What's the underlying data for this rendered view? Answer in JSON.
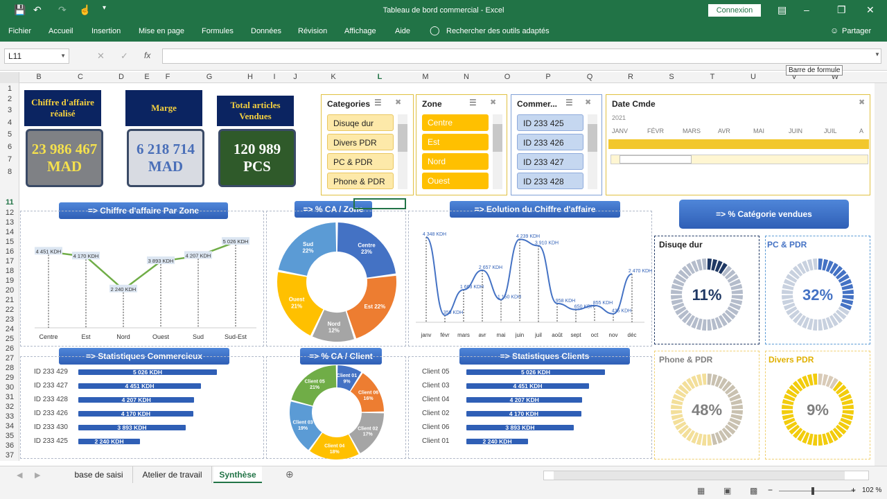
{
  "titlebar": {
    "title": "Tableau de bord commercial  -  Excel",
    "login": "Connexion"
  },
  "ribbon": {
    "tabs": [
      "Fichier",
      "Accueil",
      "Insertion",
      "Mise en page",
      "Formules",
      "Données",
      "Révision",
      "Affichage",
      "Aide"
    ],
    "search": "Rechercher des outils adaptés",
    "share": "Partager"
  },
  "formula": {
    "namebox": "L11",
    "fx": "fx",
    "tooltip": "Barre de formule"
  },
  "columns": [
    "B",
    "C",
    "D",
    "E",
    "F",
    "G",
    "H",
    "I",
    "J",
    "K",
    "L",
    "M",
    "N",
    "O",
    "P",
    "Q",
    "R",
    "S",
    "T",
    "U",
    "V",
    "W"
  ],
  "rows": [
    "1",
    "2",
    "3",
    "4",
    "5",
    "6",
    "7",
    "8",
    "11",
    "12",
    "13",
    "14",
    "15",
    "16",
    "17",
    "18",
    "19",
    "20",
    "21",
    "22",
    "23",
    "24",
    "25",
    "26",
    "27",
    "28",
    "29",
    "30",
    "31",
    "32",
    "33",
    "34",
    "35",
    "36",
    "37"
  ],
  "kpis": [
    {
      "title": "Chiffre d'affaire réalisé",
      "value1": "23 986 467",
      "value2": "MAD",
      "color": "#7f8185",
      "textcolor": "#f4e04d"
    },
    {
      "title": "Marge",
      "value1": "6 218 714",
      "value2": "MAD",
      "color": "#d8dbe2",
      "textcolor": "#4a6fb8"
    },
    {
      "title": "Total articles Vendues",
      "value1": "120 989",
      "value2": "PCS",
      "color": "#2f5a2a",
      "textcolor": "#ffffff"
    }
  ],
  "slicers": {
    "categories": {
      "title": "Categories",
      "items": [
        "Disuqe dur",
        "Divers PDR",
        "PC & PDR",
        "Phone &  PDR"
      ]
    },
    "zone": {
      "title": "Zone",
      "items": [
        "Centre",
        "Est",
        "Nord",
        "Ouest"
      ]
    },
    "commercial": {
      "title": "Commer...",
      "items": [
        "ID 233 425",
        "ID 233 426",
        "ID 233 427",
        "ID 233 428"
      ]
    },
    "date": {
      "title": "Date Cmde",
      "year": "2021",
      "months": [
        "JANV",
        "FÉVR",
        "MARS",
        "AVR",
        "MAI",
        "JUIN",
        "JUIL",
        "A"
      ]
    }
  },
  "banners": {
    "zone_ca": "=> Chiffre  d'affaire Par Zone",
    "pct_zone": "=> % CA / Zone",
    "evolution": "=> Eolution du Chiffre d'affaire",
    "pct_cat": "=> % Catégorie vendues",
    "stat_com": "=> Statistiques Commercieux",
    "pct_client": "=> % CA / Client",
    "stat_cli": "=> Statistiques Clients"
  },
  "chart_data": [
    {
      "type": "line",
      "title": "",
      "categories": [
        "Centre",
        "Est",
        "Nord",
        "Ouest",
        "Sud",
        "Sud-Est"
      ],
      "values": [
        4451,
        4170,
        2240,
        3893,
        4207,
        5026
      ],
      "labels": [
        "4 451 KDH",
        "4 170 KDH",
        "2 240 KDH",
        "3 893 KDH",
        "4 207 KDH",
        "5 026 KDH"
      ]
    },
    {
      "type": "pie",
      "title": "",
      "categories": [
        "Centre",
        "Est",
        "Nord",
        "Ouest",
        "Sud"
      ],
      "values": [
        23,
        22,
        12,
        21,
        22
      ],
      "labels": [
        "Centre\n23%",
        "Est 22%",
        "Nord\n12%",
        "Ouest\n21%",
        "Sud\n22%"
      ],
      "colors": [
        "#4472c4",
        "#ed7d31",
        "#a5a5a5",
        "#ffc000",
        "#5b9bd5"
      ]
    },
    {
      "type": "line",
      "title": "",
      "categories": [
        "janv",
        "févr",
        "mars",
        "avr",
        "mai",
        "juin",
        "juil",
        "août",
        "sept",
        "oct",
        "nov",
        "déc"
      ],
      "values": [
        4348,
        359,
        1663,
        2657,
        1150,
        4239,
        3910,
        958,
        650,
        855,
        435,
        2470
      ],
      "labels": [
        "4 348 KDH",
        "359 KDH",
        "1 663 KDH",
        "2 657 KDH",
        "1 150 KDH",
        "4 239 KDH",
        "3 910 KDH",
        "958 KDH",
        "650 KDH",
        "855 KDH",
        "435 KDH",
        "2 470 KDH"
      ]
    },
    {
      "type": "pie",
      "title": "",
      "categories": [
        "Client 01",
        "Client 06",
        "Client 02",
        "Client 04",
        "Client 03",
        "Client 05"
      ],
      "values": [
        9,
        16,
        17,
        18,
        19,
        21
      ],
      "labels": [
        "Client 01\n9%",
        "Client 06\n16%",
        "Client 02\n17%",
        "Client 04\n18%",
        "Client 03\n19%",
        "Client 05\n21%"
      ],
      "colors": [
        "#4472c4",
        "#ed7d31",
        "#a5a5a5",
        "#ffc000",
        "#5b9bd5",
        "#70ad47"
      ]
    },
    {
      "type": "bar",
      "title": "",
      "categories": [
        "ID 233 429",
        "ID 233 427",
        "ID 233 428",
        "ID 233 426",
        "ID 233 430",
        "ID 233 425"
      ],
      "values": [
        5026,
        4451,
        4207,
        4170,
        3893,
        2240
      ],
      "labels": [
        "5 026 KDH",
        "4 451 KDH",
        "4 207 KDH",
        "4 170 KDH",
        "3 893 KDH",
        "2 240 KDH"
      ]
    },
    {
      "type": "bar",
      "title": "",
      "categories": [
        "Client 05",
        "Client 03",
        "Client 04",
        "Client 02",
        "Client 06",
        "Client 01"
      ],
      "values": [
        5026,
        4451,
        4207,
        4170,
        3893,
        2240
      ],
      "labels": [
        "5 026 KDH",
        "4 451 KDH",
        "4 207 KDH",
        "4 170 KDH",
        "3 893 KDH",
        "2 240 KDH"
      ]
    }
  ],
  "gauges": [
    {
      "title": "Disuqe dur",
      "pct": 11,
      "label": "11%",
      "color": "#1f3864",
      "bg": "#b4bccb",
      "text": "#1f3864"
    },
    {
      "title": "PC & PDR",
      "pct": 32,
      "label": "32%",
      "color": "#4472c4",
      "bg": "#c8d1df",
      "text": "#4472c4",
      "titlecolor": "#4472c4"
    },
    {
      "title": "Phone &  PDR",
      "pct": 48,
      "label": "48%",
      "color": "#c9c1b0",
      "bg": "#f3df9a",
      "text": "#7f7f7f",
      "titlecolor": "#7f7f7f"
    },
    {
      "title": "Divers PDR",
      "pct": 9,
      "label": "9%",
      "color": "#d9cbb8",
      "bg": "#f2cc0d",
      "text": "#7f7f7f",
      "titlecolor": "#e0b000"
    }
  ],
  "sheets": [
    "base de saisi",
    "Atelier de travail",
    "Synthèse"
  ],
  "status": {
    "zoom": "102 %"
  }
}
